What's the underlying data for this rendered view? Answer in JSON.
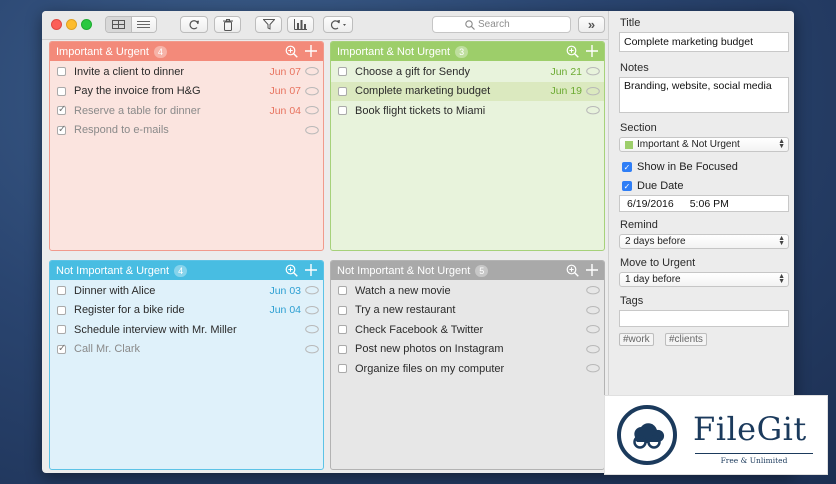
{
  "toolbar": {
    "search_placeholder": "Search",
    "expand_label": "»"
  },
  "colors": {
    "urgent_important": "#f38a7a",
    "important_not_urgent": "#9dce6a",
    "not_important_urgent": "#48bde2",
    "not_important_not_urgent": "#a9a9a9"
  },
  "quadrants": [
    {
      "title": "Important & Urgent",
      "count": "4",
      "tasks": [
        {
          "label": "Invite a client to dinner",
          "date": "Jun 07",
          "done": false
        },
        {
          "label": "Pay the invoice from H&G",
          "date": "Jun 07",
          "done": false
        },
        {
          "label": "Reserve a table for dinner",
          "date": "Jun 04",
          "done": true
        },
        {
          "label": "Respond to e-mails",
          "date": "",
          "done": true
        }
      ]
    },
    {
      "title": "Important & Not Urgent",
      "count": "3",
      "tasks": [
        {
          "label": "Choose a gift for Sendy",
          "date": "Jun 21",
          "done": false
        },
        {
          "label": "Complete marketing budget",
          "date": "Jun 19",
          "done": false
        },
        {
          "label": "Book flight tickets to Miami",
          "date": "",
          "done": false
        }
      ]
    },
    {
      "title": "Not Important & Urgent",
      "count": "4",
      "tasks": [
        {
          "label": "Dinner with Alice",
          "date": "Jun 03",
          "done": false
        },
        {
          "label": "Register for a bike ride",
          "date": "Jun 04",
          "done": false
        },
        {
          "label": "Schedule interview with Mr. Miller",
          "date": "",
          "done": false
        },
        {
          "label": "Call Mr. Clark",
          "date": "",
          "done": true
        }
      ]
    },
    {
      "title": "Not Important & Not Urgent",
      "count": "5",
      "tasks": [
        {
          "label": "Watch a new movie",
          "date": "",
          "done": false
        },
        {
          "label": "Try a new restaurant",
          "date": "",
          "done": false
        },
        {
          "label": "Check Facebook & Twitter",
          "date": "",
          "done": false
        },
        {
          "label": "Post new photos on Instagram",
          "date": "",
          "done": false
        },
        {
          "label": "Organize files on my computer",
          "date": "",
          "done": false
        }
      ]
    }
  ],
  "details": {
    "title_label": "Title",
    "title_value": "Complete marketing budget",
    "notes_label": "Notes",
    "notes_value": "Branding, website, social media",
    "section_label": "Section",
    "section_value": "Important & Not Urgent",
    "show_focused_label": "Show in Be Focused",
    "due_date_label": "Due Date",
    "due_date_value": "6/19/2016",
    "due_time_value": "5:06 PM",
    "remind_label": "Remind",
    "remind_value": "2 days before",
    "move_label": "Move to Urgent",
    "move_value": "1 day before",
    "tags_label": "Tags",
    "tags": [
      "#work",
      "#clients"
    ]
  },
  "watermark": {
    "name": "FileGit",
    "tagline": "Free & Unlimited"
  }
}
